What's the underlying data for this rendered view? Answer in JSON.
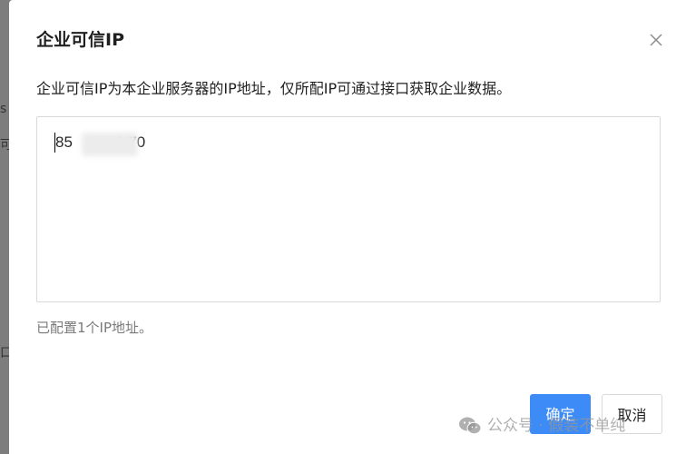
{
  "backdrop": {
    "fragment_top": "s",
    "fragment_mid": "可",
    "fragment_low": "口"
  },
  "dialog": {
    "title": "企业可信IP",
    "description": "企业可信IP为本企业服务器的IP地址，仅所配IP可通过接口获取企业数据。",
    "ip_input": {
      "value": "85          1.70"
    },
    "configured_count": "已配置1个IP地址。",
    "confirm_label": "确定",
    "cancel_label": "取消"
  },
  "watermark": {
    "text": "公众号 · 假装不单纯",
    "icon": "wechat-icon"
  },
  "colors": {
    "primary": "#3d8bf7",
    "overlay": "#7d7d7d"
  }
}
